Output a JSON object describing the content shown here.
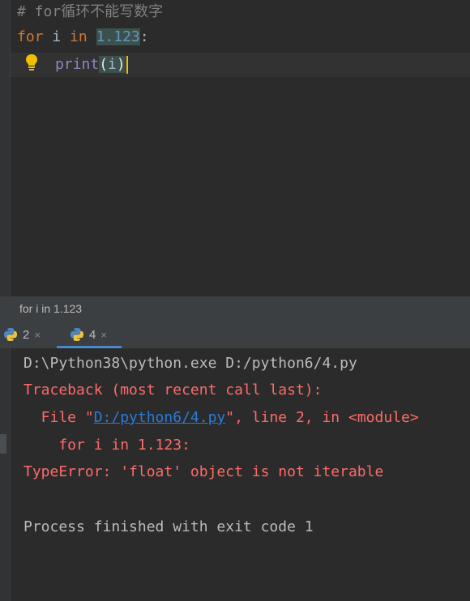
{
  "editor": {
    "line1": {
      "comment_prefix": "# for",
      "comment_cjk": "循环不能写数字"
    },
    "line2": {
      "kw_for": "for",
      "var_i": " i ",
      "kw_in": "in",
      "space": " ",
      "number": "1.123",
      "colon": ":"
    },
    "line3": {
      "builtin": "print",
      "open_paren": "(",
      "arg": "i",
      "close_paren": ")"
    }
  },
  "breadcrumb": {
    "text": "for i in 1.123"
  },
  "run_tabs": [
    {
      "label": "2",
      "close": "×"
    },
    {
      "label": "4",
      "close": "×",
      "active": true
    }
  ],
  "console": {
    "cmd": "D:\\Python38\\python.exe D:/python6/4.py",
    "traceback_header": "Traceback (most recent call last):",
    "file_prefix": "  File \"",
    "file_link": "D:/python6/4.py",
    "file_suffix": "\", line 2, in <module>",
    "code_line": "    for i in 1.123:",
    "error": "TypeError: 'float' object is not iterable",
    "exit": "Process finished with exit code 1"
  },
  "colors": {
    "background": "#2b2b2b",
    "keyword": "#cc7832",
    "number": "#6897bb",
    "error": "#ff6b68",
    "link": "#287bde",
    "comment": "#808080"
  },
  "icons": {
    "intention": "lightbulb-icon",
    "run_tab": "python-icon",
    "tab_close": "close-icon"
  }
}
